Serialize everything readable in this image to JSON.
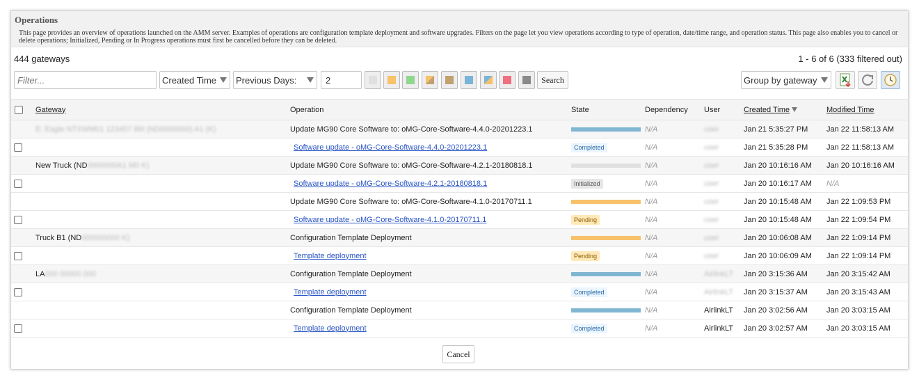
{
  "header": {
    "title": "Operations",
    "description": "This page provides an overview of operations launched on the AMM server. Examples of operations are configuration template deployment and software upgrades. Filters on the page let you view operations according to type of operation, date/time range, and operation status. This page also enables you to cancel or delete operations; Initialized, Pending or In Progress operations must first be cancelled before they can be deleted."
  },
  "summary": {
    "gateway_count": "444 gateways",
    "pagination": "1 - 6 of 6 (333 filtered out)"
  },
  "toolbar": {
    "filter_placeholder": "Filter...",
    "time_field": "Created Time",
    "range_type": "Previous Days:",
    "range_value": "2",
    "search_label": "Search",
    "group_by": "Group by gateway",
    "status_colors": [
      "#e0e0e0",
      "#f7c26a",
      "#8fd68f",
      "#d9a95b",
      "#c2a070",
      "#7bb4d8",
      "#7bb4d8",
      "#f07080",
      "#8a8a8a"
    ]
  },
  "table": {
    "columns": {
      "gateway": "Gateway",
      "operation": "Operation",
      "state": "State",
      "dependency": "Dependency",
      "user": "User",
      "created_time": "Created Time",
      "modified_time": "Modified Time"
    },
    "rows": [
      {
        "gateway": "",
        "operation": "Update MG90 Core Software to: oMG-Core-Software-4.4.0-20201223.1",
        "state_color": "#7fb6d2",
        "state_label": "",
        "dependency": "N/A",
        "user": "",
        "created": "Jan 21 5:35:27 PM",
        "modified": "Jan 22 11:58:13 AM"
      },
      {
        "gateway": "",
        "operation": "Software update - oMG-Core-Software-4.4.0-20201223.1",
        "state_label": "Completed",
        "dependency": "N/A",
        "user": "",
        "created": "Jan 21 5:35:28 PM",
        "modified": "Jan 22 11:58:13 AM"
      },
      {
        "gateway": "New Truck (ND",
        "operation": "Update MG90 Core Software to: oMG-Core-Software-4.2.1-20180818.1",
        "state_color": "#e0e0e0",
        "state_label": "",
        "dependency": "N/A",
        "user": "",
        "created": "Jan 20 10:16:16 AM",
        "modified": "Jan 20 10:16:16 AM"
      },
      {
        "gateway": "",
        "operation": "Software update - oMG-Core-Software-4.2.1-20180818.1",
        "state_label": "Initialized",
        "dependency": "N/A",
        "user": "",
        "created": "Jan 20 10:16:17 AM",
        "modified": "N/A"
      },
      {
        "gateway": "",
        "operation": "Update MG90 Core Software to: oMG-Core-Software-4.1.0-20170711.1",
        "state_color": "#f7c26a",
        "state_label": "",
        "dependency": "N/A",
        "user": "",
        "created": "Jan 20 10:15:48 AM",
        "modified": "Jan 22 1:09:53 PM"
      },
      {
        "gateway": "",
        "operation": "Software update - oMG-Core-Software-4.1.0-20170711.1",
        "state_label": "Pending",
        "dependency": "N/A",
        "user": "",
        "created": "Jan 20 10:15:48 AM",
        "modified": "Jan 22 1:09:54 PM"
      },
      {
        "gateway": "Truck B1 (ND",
        "operation": "Configuration Template Deployment",
        "state_color": "#f7c26a",
        "state_label": "",
        "dependency": "N/A",
        "user": "",
        "created": "Jan 20 10:06:08 AM",
        "modified": "Jan 22 1:09:14 PM"
      },
      {
        "gateway": "",
        "operation": "Template deployment",
        "state_label": "Pending",
        "dependency": "N/A",
        "user": "",
        "created": "Jan 20 10:06:09 AM",
        "modified": "Jan 22 1:09:14 PM"
      },
      {
        "gateway": "LA",
        "operation": "Configuration Template Deployment",
        "state_color": "#7fb6d2",
        "state_label": "",
        "dependency": "N/A",
        "user": "",
        "created": "Jan 20 3:15:36 AM",
        "modified": "Jan 20 3:15:42 AM"
      },
      {
        "gateway": "",
        "operation": "Template deployment",
        "state_label": "Completed",
        "dependency": "N/A",
        "user": "",
        "created": "Jan 20 3:15:37 AM",
        "modified": "Jan 20 3:15:43 AM"
      },
      {
        "gateway": "",
        "operation": "Configuration Template Deployment",
        "state_color": "#7fb6d2",
        "state_label": "",
        "dependency": "N/A",
        "user": "AirlinkLT",
        "created": "Jan 20 3:02:56 AM",
        "modified": "Jan 20 3:03:15 AM"
      },
      {
        "gateway": "",
        "operation": "Template deployment",
        "state_label": "Completed",
        "dependency": "N/A",
        "user": "AirlinkLT",
        "created": "Jan 20 3:02:57 AM",
        "modified": "Jan 20 3:03:15 AM"
      }
    ]
  },
  "footer": {
    "cancel_label": "Cancel"
  }
}
